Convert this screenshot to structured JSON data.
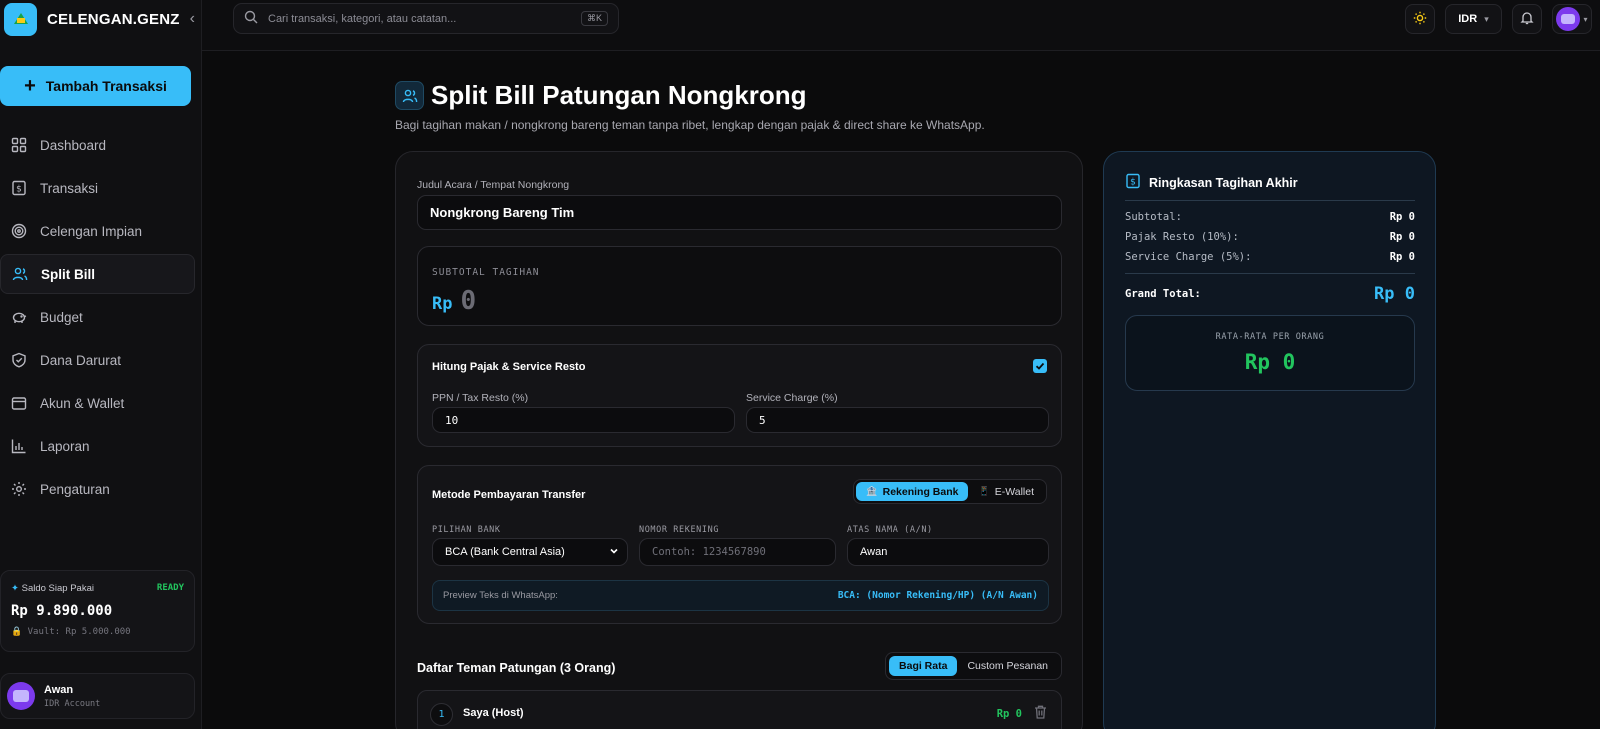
{
  "app": {
    "brand_name": "CELENGAN.GENZ",
    "add_transaction_label": "Tambah Transaksi"
  },
  "sidebar": {
    "items": [
      {
        "label": "Dashboard",
        "icon": "grid-icon"
      },
      {
        "label": "Transaksi",
        "icon": "dollar-doc-icon"
      },
      {
        "label": "Celengan Impian",
        "icon": "target-icon"
      },
      {
        "label": "Split Bill",
        "icon": "users-icon",
        "active": true
      },
      {
        "label": "Budget",
        "icon": "piggy-bank-icon"
      },
      {
        "label": "Dana Darurat",
        "icon": "shield-icon"
      },
      {
        "label": "Akun & Wallet",
        "icon": "wallet-icon"
      },
      {
        "label": "Laporan",
        "icon": "bar-chart-icon"
      },
      {
        "label": "Pengaturan",
        "icon": "gear-icon"
      }
    ],
    "saldo": {
      "label": "Saldo Siap Pakai",
      "status": "READY",
      "amount": "Rp 9.890.000",
      "vault": "Vault: Rp 5.000.000"
    },
    "user": {
      "name": "Awan",
      "account": "IDR Account"
    }
  },
  "topbar": {
    "search_placeholder": "Cari transaksi, kategori, atau catatan...",
    "shortcut": "⌘K",
    "currency": "IDR"
  },
  "page": {
    "title": "Split Bill Patungan Nongkrong",
    "subtitle": "Bagi tagihan makan / nongkrong bareng teman tanpa ribet, lengkap dengan pajak & direct share ke WhatsApp."
  },
  "form": {
    "event_label": "Judul Acara / Tempat Nongkrong",
    "event_value": "Nongkrong Bareng Tim",
    "subtotal_label": "SUBTOTAL TAGIHAN",
    "subtotal_currency": "Rp",
    "subtotal_value": "0",
    "tax": {
      "title": "Hitung Pajak & Service Resto",
      "enabled": true,
      "ppn_label": "PPN / Tax Resto (%)",
      "ppn_value": "10",
      "service_label": "Service Charge (%)",
      "service_value": "5"
    },
    "payment": {
      "title": "Metode Pembayaran Transfer",
      "tab_bank": "Rekening Bank",
      "tab_ewallet": "E-Wallet",
      "bank_label": "PILIHAN BANK",
      "bank_value": "BCA (Bank Central Asia)",
      "norek_label": "NOMOR REKENING",
      "norek_placeholder": "Contoh: 1234567890",
      "name_label": "ATAS NAMA (A/N)",
      "name_value": "Awan",
      "preview_label": "Preview Teks di WhatsApp:",
      "preview_value": "BCA: (Nomor Rekening/HP) (A/N Awan)"
    },
    "friends": {
      "title": "Daftar Teman Patungan (3 Orang)",
      "mode_equal": "Bagi Rata",
      "mode_custom": "Custom Pesanan",
      "rows": [
        {
          "index": "1",
          "name": "Saya (Host)",
          "amount": "Rp 0"
        }
      ]
    }
  },
  "summary": {
    "title": "Ringkasan Tagihan Akhir",
    "subtotal_label": "Subtotal:",
    "subtotal_value": "Rp 0",
    "tax_label": "Pajak Resto (10%):",
    "tax_value": "Rp 0",
    "service_label": "Service Charge (5%):",
    "service_value": "Rp 0",
    "grand_label": "Grand Total:",
    "grand_value": "Rp 0",
    "avg_label": "RATA-RATA PER ORANG",
    "avg_value": "Rp 0"
  },
  "colors": {
    "accent": "#38bdf8",
    "success": "#22c55e",
    "background": "#0b0b0c"
  }
}
